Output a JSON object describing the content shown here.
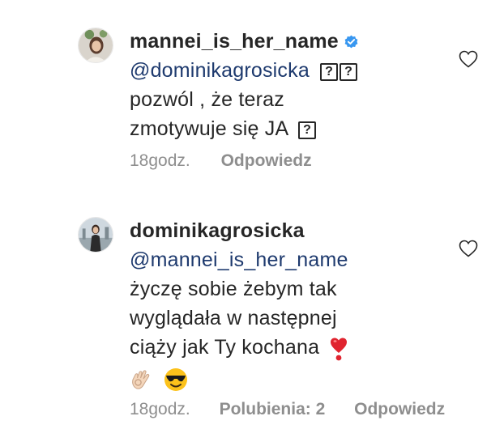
{
  "comments": [
    {
      "username": "mannei_is_her_name",
      "verified": true,
      "mention": "@dominikagrosicka",
      "mention_glyphs": [
        "?",
        "?"
      ],
      "text_lines": [
        "pozwól , że teraz",
        "zmotywuje się JA"
      ],
      "trailing_glyph": "?",
      "time": "18godz.",
      "reply_label": "Odpowiedz",
      "icons": [
        "verified-badge-icon",
        "heart-icon"
      ]
    },
    {
      "username": "dominikagrosicka",
      "verified": false,
      "mention": "@mannei_is_her_name",
      "text_lines": [
        "życzę sobie żebym tak",
        "wyglądała w następnej",
        "ciąży jak Ty kochana"
      ],
      "emojis": [
        "heart-exclamation-emoji",
        "ok-hand-emoji",
        "sunglasses-emoji"
      ],
      "time": "18godz.",
      "likes_label": "Polubienia: 2",
      "reply_label": "Odpowiedz",
      "icons": [
        "heart-icon"
      ]
    }
  ],
  "colors": {
    "text": "#262626",
    "mention": "#1e3a6e",
    "meta": "#8e8e8e",
    "verified": "#3897f0",
    "emoji_red": "#e0242f"
  }
}
